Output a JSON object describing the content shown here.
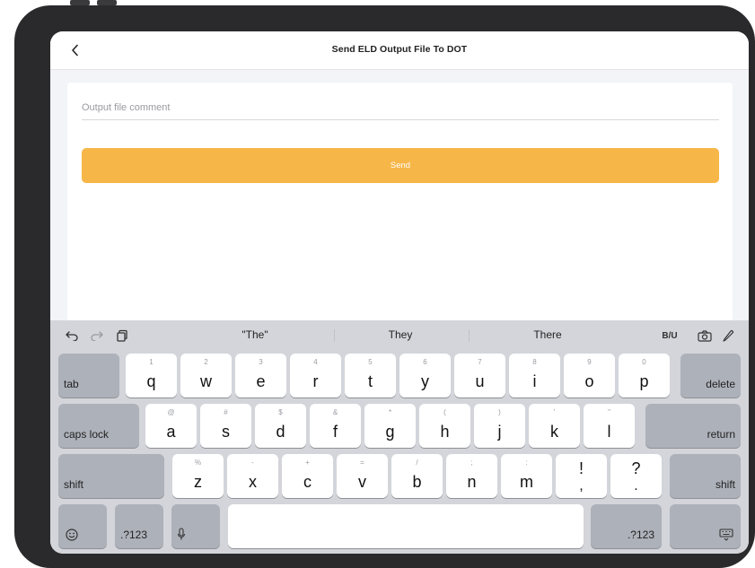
{
  "navbar": {
    "back_icon": "chevron-left-icon",
    "title": "Send ELD Output File To DOT"
  },
  "form": {
    "comment_placeholder": "Output file comment",
    "comment_value": "",
    "send_label": "Send"
  },
  "colors": {
    "accent": "#f7b648",
    "keyboard_bg": "#d3d5da"
  },
  "keyboard": {
    "toolbar_left_icons": [
      "undo-icon",
      "redo-icon",
      "paste-icon"
    ],
    "suggestions": [
      "\"The\"",
      "They",
      "There"
    ],
    "format_label": "B/U",
    "toolbar_right_icons": [
      "camera-icon",
      "markup-pen-icon"
    ],
    "row1": [
      {
        "main": "q",
        "sec": "1"
      },
      {
        "main": "w",
        "sec": "2"
      },
      {
        "main": "e",
        "sec": "3"
      },
      {
        "main": "r",
        "sec": "4"
      },
      {
        "main": "t",
        "sec": "5"
      },
      {
        "main": "y",
        "sec": "6"
      },
      {
        "main": "u",
        "sec": "7"
      },
      {
        "main": "i",
        "sec": "8"
      },
      {
        "main": "o",
        "sec": "9"
      },
      {
        "main": "p",
        "sec": "0"
      }
    ],
    "row2": [
      {
        "main": "a",
        "sec": "@"
      },
      {
        "main": "s",
        "sec": "#"
      },
      {
        "main": "d",
        "sec": "$"
      },
      {
        "main": "f",
        "sec": "&"
      },
      {
        "main": "g",
        "sec": "*"
      },
      {
        "main": "h",
        "sec": "("
      },
      {
        "main": "j",
        "sec": ")"
      },
      {
        "main": "k",
        "sec": "'"
      },
      {
        "main": "l",
        "sec": "\""
      }
    ],
    "row3": [
      {
        "main": "z",
        "sec": "%"
      },
      {
        "main": "x",
        "sec": "-"
      },
      {
        "main": "c",
        "sec": "+"
      },
      {
        "main": "v",
        "sec": "="
      },
      {
        "main": "b",
        "sec": "/"
      },
      {
        "main": "n",
        "sec": ";"
      },
      {
        "main": "m",
        "sec": ":"
      }
    ],
    "punct1": {
      "top": "!",
      "bottom": ","
    },
    "punct2": {
      "top": "?",
      "bottom": "."
    },
    "tab": "tab",
    "delete": "delete",
    "caps_lock": "caps lock",
    "return": "return",
    "shift": "shift",
    "numbers": ".?123",
    "emoji_icon": "emoji-icon",
    "mic_icon": "microphone-icon",
    "hide_keyboard_icon": "keyboard-dismiss-icon"
  }
}
